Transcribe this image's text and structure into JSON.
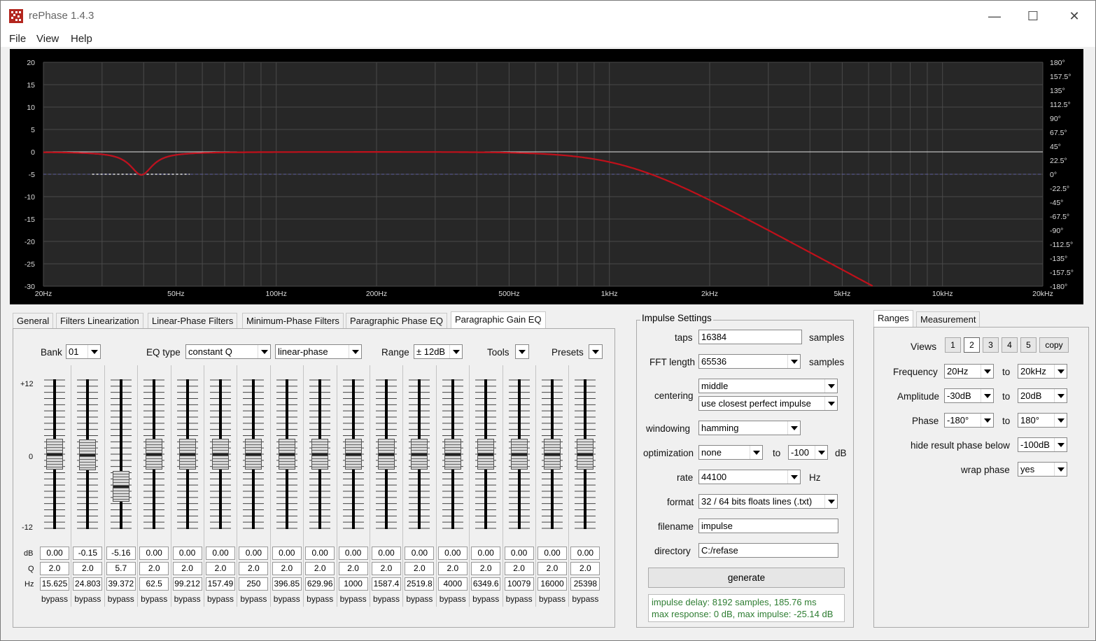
{
  "window": {
    "title": "rePhase 1.4.3",
    "minimize": "—",
    "maximize": "☐",
    "close": "✕"
  },
  "menu": {
    "file": "File",
    "view": "View",
    "help": "Help"
  },
  "graph": {
    "y_left_labels": [
      "20",
      "15",
      "10",
      "5",
      "0",
      "-5",
      "-10",
      "-15",
      "-20",
      "-25",
      "-30"
    ],
    "y_right_labels": [
      "180°",
      "157.5°",
      "135°",
      "112.5°",
      "90°",
      "67.5°",
      "45°",
      "22.5°",
      "0°",
      "-22.5°",
      "-45°",
      "-67.5°",
      "-90°",
      "-112.5°",
      "-135°",
      "-157.5°",
      "-180°"
    ],
    "x_labels": [
      "20Hz",
      "50Hz",
      "100Hz",
      "200Hz",
      "500Hz",
      "1kHz",
      "2kHz",
      "5kHz",
      "10kHz",
      "20kHz"
    ],
    "x_label_freqs": [
      20,
      50,
      100,
      200,
      500,
      1000,
      2000,
      5000,
      10000,
      20000
    ],
    "amplitude_range_db": [
      -30,
      20
    ],
    "colors": {
      "background": "#272727",
      "grid": "#4a4a4a",
      "response": "#c0101a",
      "filter": "#3f5fd0",
      "zero_line": "#e0e0e0",
      "phase_ref": "#6060a0"
    }
  },
  "tabs_left": [
    "General",
    "Filters Linearization",
    "Linear-Phase Filters",
    "Minimum-Phase Filters",
    "Paragraphic Phase EQ",
    "Paragraphic Gain EQ"
  ],
  "eq": {
    "bank_label": "Bank",
    "bank_value": "01",
    "eqtype_label": "EQ type",
    "eqtype_value": "constant Q",
    "phase_value": "linear-phase",
    "range_label": "Range",
    "range_value": "± 12dB",
    "tools_label": "Tools",
    "presets_label": "Presets",
    "scale_top": "+12",
    "scale_mid": "0",
    "scale_bottom": "-12",
    "row_db": "dB",
    "row_q": "Q",
    "row_hz": "Hz",
    "bypass_label": "bypass",
    "bands": [
      {
        "db": "0.00",
        "q": "2.0",
        "hz": "15.625"
      },
      {
        "db": "-0.15",
        "q": "2.0",
        "hz": "24.803"
      },
      {
        "db": "-5.16",
        "q": "5.7",
        "hz": "39.372"
      },
      {
        "db": "0.00",
        "q": "2.0",
        "hz": "62.5"
      },
      {
        "db": "0.00",
        "q": "2.0",
        "hz": "99.212"
      },
      {
        "db": "0.00",
        "q": "2.0",
        "hz": "157.49"
      },
      {
        "db": "0.00",
        "q": "2.0",
        "hz": "250"
      },
      {
        "db": "0.00",
        "q": "2.0",
        "hz": "396.85"
      },
      {
        "db": "0.00",
        "q": "2.0",
        "hz": "629.96"
      },
      {
        "db": "0.00",
        "q": "2.0",
        "hz": "1000"
      },
      {
        "db": "0.00",
        "q": "2.0",
        "hz": "1587.4"
      },
      {
        "db": "0.00",
        "q": "2.0",
        "hz": "2519.8"
      },
      {
        "db": "0.00",
        "q": "2.0",
        "hz": "4000"
      },
      {
        "db": "0.00",
        "q": "2.0",
        "hz": "6349.6"
      },
      {
        "db": "0.00",
        "q": "2.0",
        "hz": "10079"
      },
      {
        "db": "0.00",
        "q": "2.0",
        "hz": "16000"
      },
      {
        "db": "0.00",
        "q": "2.0",
        "hz": "25398"
      }
    ]
  },
  "impulse": {
    "title": "Impulse Settings",
    "taps_label": "taps",
    "taps_value": "16384",
    "taps_unit": "samples",
    "fft_label": "FFT length",
    "fft_value": "65536",
    "fft_unit": "samples",
    "centering_label": "centering",
    "centering_value": "middle",
    "centering_mode": "use closest perfect impulse",
    "windowing_label": "windowing",
    "windowing_value": "hamming",
    "optimization_label": "optimization",
    "optimization_value": "none",
    "optimization_to": "to",
    "optimization_db": "-100",
    "optimization_unit": "dB",
    "rate_label": "rate",
    "rate_value": "44100",
    "rate_unit": "Hz",
    "format_label": "format",
    "format_value": "32 / 64 bits floats lines (.txt)",
    "filename_label": "filename",
    "filename_value": "impulse",
    "directory_label": "directory",
    "directory_value": "C:/refase",
    "generate_label": "generate",
    "status_line1": "impulse delay: 8192 samples, 185.76 ms",
    "status_line2": "max response: 0 dB, max impulse: -25.14 dB"
  },
  "tabs_right": [
    "Ranges",
    "Measurement"
  ],
  "ranges": {
    "views_label": "Views",
    "views": [
      "1",
      "2",
      "3",
      "4",
      "5"
    ],
    "copy_label": "copy",
    "active_view": "2",
    "to": "to",
    "frequency_label": "Frequency",
    "freq_from": "20Hz",
    "freq_to": "20kHz",
    "amplitude_label": "Amplitude",
    "amp_from": "-30dB",
    "amp_to": "20dB",
    "phase_label": "Phase",
    "phase_from": "-180°",
    "phase_to": "180°",
    "hide_label": "hide result phase below",
    "hide_value": "-100dB",
    "wrap_label": "wrap phase",
    "wrap_value": "yes"
  }
}
